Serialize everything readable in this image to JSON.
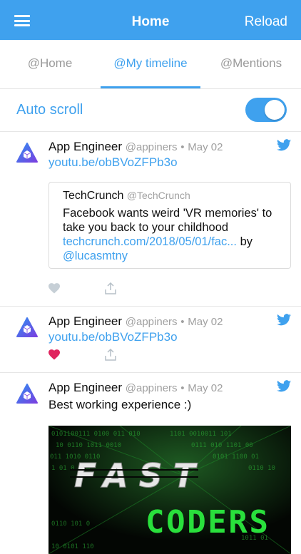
{
  "nav": {
    "title": "Home",
    "reload": "Reload"
  },
  "tabs": [
    {
      "label": "@Home"
    },
    {
      "label": "@My timeline"
    },
    {
      "label": "@Mentions"
    }
  ],
  "autoscroll": {
    "label": "Auto scroll",
    "enabled": true
  },
  "tweets": [
    {
      "name": "App Engineer",
      "handle": "@appiners",
      "date": "May 02",
      "link": "youtu.be/obBVoZFPb3o",
      "quote": {
        "name": "TechCrunch",
        "handle": "@TechCrunch",
        "text": "Facebook wants weird 'VR memories' to take you back to your childhood",
        "link": "techcrunch.com/2018/05/01/fac...",
        "by": "by",
        "mention": "@lucasmtny"
      },
      "liked": false
    },
    {
      "name": "App Engineer",
      "handle": "@appiners",
      "date": "May 02",
      "link": "youtu.be/obBVoZFPb3o",
      "liked": true
    },
    {
      "name": "App Engineer",
      "handle": "@appiners",
      "date": "May 02",
      "text": "Best working experience :)",
      "media": {
        "line1": "FAST",
        "line2": "CODERS"
      }
    }
  ],
  "colors": {
    "accent": "#3fa1ee",
    "heart_liked": "#e0245e",
    "heart_unliked": "#c6cfd6",
    "code_green": "#29e03c"
  },
  "icons": {
    "menu": "hamburger-icon",
    "app": "app-engineer-logo",
    "twitter": "twitter-bird-icon",
    "like": "heart-icon",
    "share": "share-icon"
  }
}
